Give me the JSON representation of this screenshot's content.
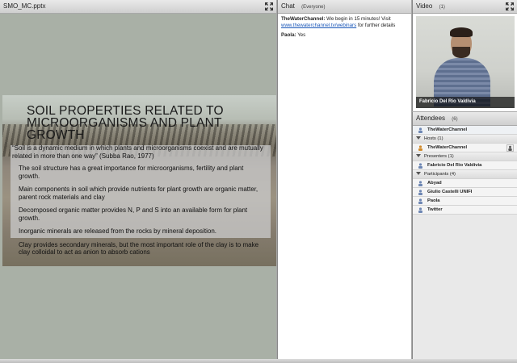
{
  "share": {
    "title": "SMO_MC.pptx",
    "slide": {
      "title": "SOIL PROPERTIES RELATED TO MICROORGANISMS AND PLANT GROWTH",
      "quote": "“Soil is a dynamic medium in which plants and microorganisms coexist and are mutually related in more than one way” (Subba Rao, 1977)",
      "bullets": [
        "The soil structure has a great importance for microorganisms, fertility and plant growth.",
        "Main components in soil which provide nutrients for plant growth are organic matter, parent rock materials and clay",
        "Decomposed organic matter provides N, P and S into an available form for plant growth.",
        "Inorganic minerals are released from the rocks by mineral deposition.",
        "Clay provides secondary minerals, but the most important role of the clay is to make clay colloidal to act as anion to absorb cations"
      ]
    }
  },
  "chat": {
    "title": "Chat",
    "scope": "(Everyone)",
    "messages": [
      {
        "name": "TheWaterChannel:",
        "text": "We begin in 15 minutes! Visit",
        "link": "www.thewaterchannel.tv/webinars",
        "after": "for further details"
      },
      {
        "name": "Paola:",
        "text": "Yes"
      }
    ]
  },
  "video": {
    "title": "Video",
    "count": "(1)",
    "caption": "Fabricio Del Rio Valdivia"
  },
  "attendees": {
    "title": "Attendees",
    "count": "(6)",
    "top_entry": "TheWaterChannel",
    "sections": [
      {
        "label": "Hosts (1)",
        "people": [
          "TheWaterChannel"
        ]
      },
      {
        "label": "Presenters (1)",
        "people": [
          "Fabricio Del Rio Valdivia"
        ]
      },
      {
        "label": "Participants (4)",
        "people": [
          "Abyad",
          "Giulio Castelli UNIFI",
          "Paola",
          "Twitter"
        ]
      }
    ]
  },
  "colors": {
    "link": "#1a57b8",
    "header": "#d9d9d9",
    "host_icon": "#d08a2a",
    "user_icon": "#6d86b3"
  }
}
